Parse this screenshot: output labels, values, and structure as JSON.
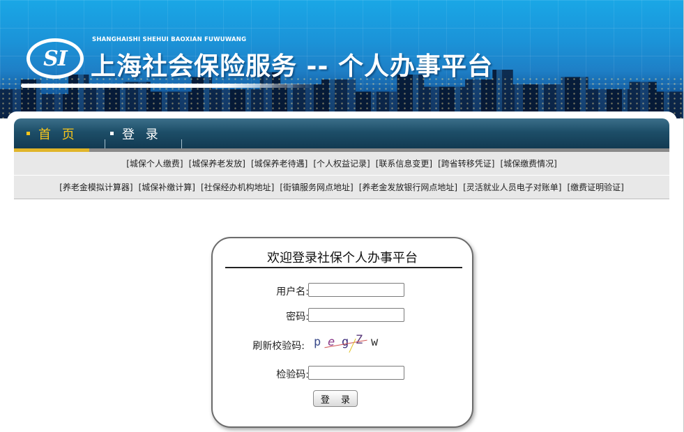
{
  "header": {
    "logo_text": "SI",
    "pinyin": "SHANGHAISHI SHEHUI BAOXIAN FUWUWANG",
    "title": "上海社会保险服务 -- 个人办事平台"
  },
  "nav": {
    "home": "首 页",
    "login": "登 录"
  },
  "links_row1": [
    "[城保个人缴费]",
    "[城保养老发放]",
    "[城保养老待遇]",
    "[个人权益记录]",
    "[联系信息变更]",
    "[跨省转移凭证]",
    "[城保缴费情况]"
  ],
  "links_row2": [
    "[养老金模拟计算器]",
    "[城保补缴计算]",
    "[社保经办机构地址]",
    "[街镇服务网点地址]",
    "[养老金发放银行网点地址]",
    "[灵活就业人员电子对账单]",
    "[缴费证明验证]"
  ],
  "login": {
    "title": "欢迎登录社保个人办事平台",
    "username_label": "用户名:",
    "password_label": "密码:",
    "refresh_label": "刷新校验码:",
    "captcha_chars": [
      "p",
      "e",
      "g",
      "Z",
      "w"
    ],
    "code_label": "检验码:",
    "submit": "登 录",
    "username_value": "",
    "password_value": "",
    "code_value": ""
  },
  "colors": {
    "accent_yellow": "#f7c51a",
    "nav_dark": "#123a52",
    "banner_blue": "#1b93d8"
  }
}
